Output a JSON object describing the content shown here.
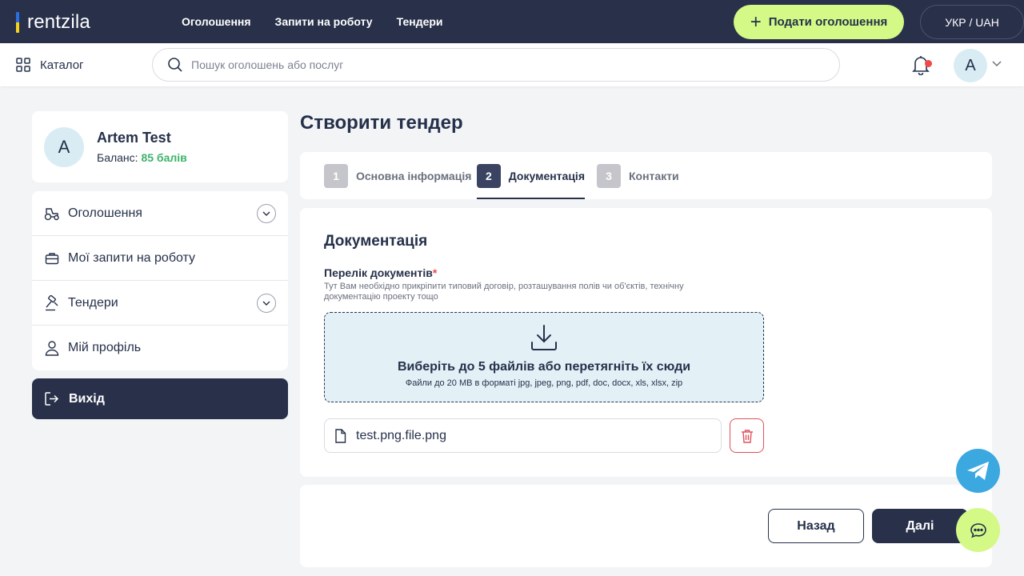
{
  "header": {
    "logo": "rentzila",
    "nav": [
      "Оголошення",
      "Запити на роботу",
      "Тендери"
    ],
    "post_label": "Подати оголошення",
    "lang_label": "УКР / UAH"
  },
  "subheader": {
    "catalog_label": "Каталог",
    "search_placeholder": "Пошук оголошень або послуг",
    "user_initial": "A"
  },
  "sidebar": {
    "profile": {
      "initial": "A",
      "name": "Artem Test",
      "balance_label": "Баланс:",
      "balance_value": "85 балів"
    },
    "items": [
      {
        "label": "Оголошення",
        "icon": "tractor-icon"
      },
      {
        "label": "Мої запити на роботу",
        "icon": "briefcase-icon"
      },
      {
        "label": "Тендери",
        "icon": "gavel-icon"
      },
      {
        "label": "Мій профіль",
        "icon": "user-icon"
      }
    ],
    "logout_label": "Вихід"
  },
  "main": {
    "title": "Створити тендер",
    "steps": [
      {
        "num": "1",
        "label": "Основна інформація"
      },
      {
        "num": "2",
        "label": "Документація"
      },
      {
        "num": "3",
        "label": "Контакти"
      }
    ],
    "active_step": 2,
    "section_title": "Документація",
    "docs_label": "Перелік документів",
    "required_mark": "*",
    "docs_help": "Тут Вам необхідно прикріпити типовий договір, розташування полів чи об'єктів, технічну документацію проекту тощо",
    "dropzone_main": "Виберіть до 5 файлів або перетягніть їх сюди",
    "dropzone_sub": "Файли до 20 MB в форматі jpg, jpeg, png, pdf, doc, docx, xls, xlsx, zip",
    "file_name": "test.png.file.png",
    "back_label": "Назад",
    "next_label": "Далі"
  },
  "colors": {
    "header_bg": "#28304a",
    "accent_green": "#d4f986",
    "balance_green": "#3db36b",
    "danger": "#e0505a",
    "telegram_blue": "#3ba8e0"
  }
}
